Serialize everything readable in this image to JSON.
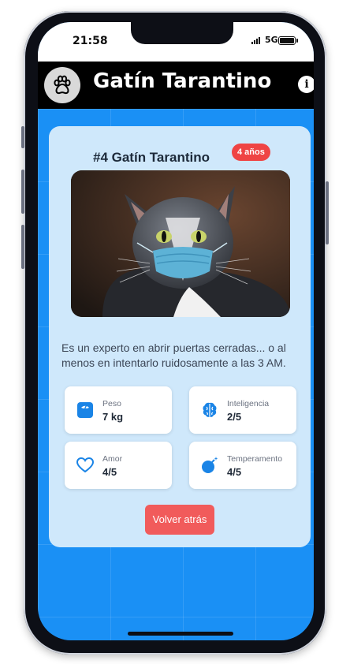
{
  "status": {
    "time": "21:58",
    "network": "5G"
  },
  "appbar": {
    "title": "Gatín Tarantino",
    "logo_icon": "paw-icon",
    "info_icon": "info-icon",
    "info_glyph": "i"
  },
  "cat": {
    "title": "#4 Gatín Tarantino",
    "age": "4 años",
    "description": "Es un experto en abrir puertas cerradas... o al menos en intentarlo ruidosamente a las 3 AM."
  },
  "stats": [
    {
      "label": "Peso",
      "value": "7 kg",
      "icon": "scale-icon"
    },
    {
      "label": "Inteligencia",
      "value": "2/5",
      "icon": "brain-icon"
    },
    {
      "label": "Amor",
      "value": "4/5",
      "icon": "heart-icon"
    },
    {
      "label": "Temperamento",
      "value": "4/5",
      "icon": "bomb-icon"
    }
  ],
  "back_button": "Volver atrás",
  "colors": {
    "accent": "#1a90f5",
    "card": "#cfe8fb",
    "badge": "#ef4444",
    "button": "#f15b5b"
  }
}
